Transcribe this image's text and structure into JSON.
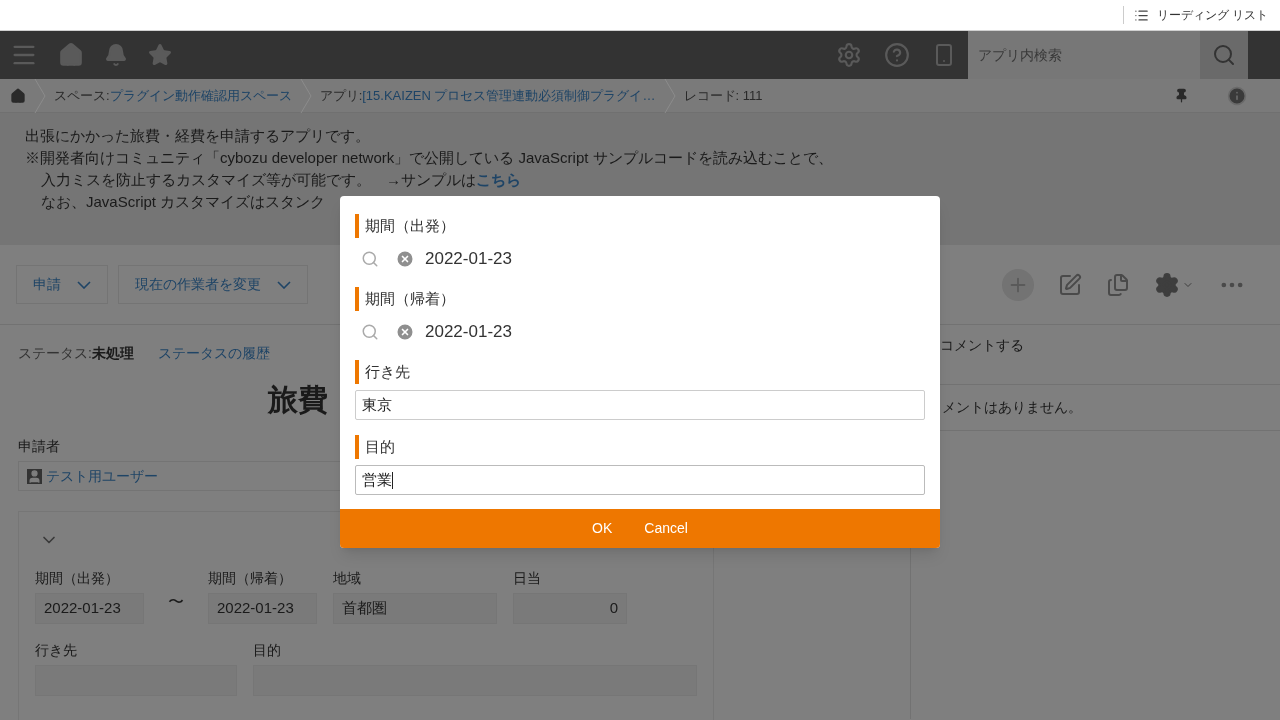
{
  "browser_bar": {
    "reading_list": "リーディング リスト"
  },
  "header": {
    "search_placeholder": "アプリ内検索"
  },
  "breadcrumbs": [
    {
      "prefix": "スペース: ",
      "link": "プラグイン動作確認用スペース"
    },
    {
      "prefix": "アプリ: ",
      "link": "[15.KAIZEN プロセス管理連動必須制御プラグイ…"
    },
    {
      "prefix": "レコード: 111"
    }
  ],
  "description": [
    {
      "text": "出張にかかった旅費・経費を申請するアプリです。"
    },
    {
      "text": "※開発者向けコミュニティ「cybozu developer network」で公開している JavaScript サンプルコードを読み込むことで、"
    },
    {
      "text": "入力ミスを防止するカスタマイズ等が可能です。　→サンプルは",
      "link": "こちら"
    },
    {
      "text": "なお、JavaScript カスタマイズはスタンク"
    }
  ],
  "actions": [
    "申請",
    "現在の作業者を変更"
  ],
  "status": {
    "label": "ステータス: ",
    "value": "未処理",
    "history": "ステータスの履歴"
  },
  "record_title": "旅費",
  "applicant": {
    "label": "申請者",
    "user": "テスト用ユーザー"
  },
  "record_fields": [
    {
      "kind": "date",
      "label": "期間（出発）",
      "value": "2022-01-23"
    },
    {
      "kind": "date",
      "label": "期間（帰着）",
      "value": "2022-01-23"
    },
    {
      "kind": "text",
      "label": "地域",
      "value": "首都圏"
    },
    {
      "kind": "number",
      "label": "日当",
      "value": "0"
    }
  ],
  "range_mark": "〜",
  "record_fields_2": [
    {
      "label": "行き先"
    },
    {
      "label": "目的"
    }
  ],
  "comments": {
    "post": "コメントする",
    "empty": "メントはありません。"
  },
  "dialog": {
    "fields": [
      {
        "kind": "date",
        "label": "期間（出発）",
        "value": "2022-01-23"
      },
      {
        "kind": "date",
        "label": "期間（帰着）",
        "value": "2022-01-23"
      },
      {
        "kind": "text",
        "label": "行き先",
        "value": "東京",
        "focused": false
      },
      {
        "kind": "text",
        "label": "目的",
        "value": "営業",
        "focused": true
      }
    ],
    "buttons": [
      "OK",
      "Cancel"
    ]
  }
}
